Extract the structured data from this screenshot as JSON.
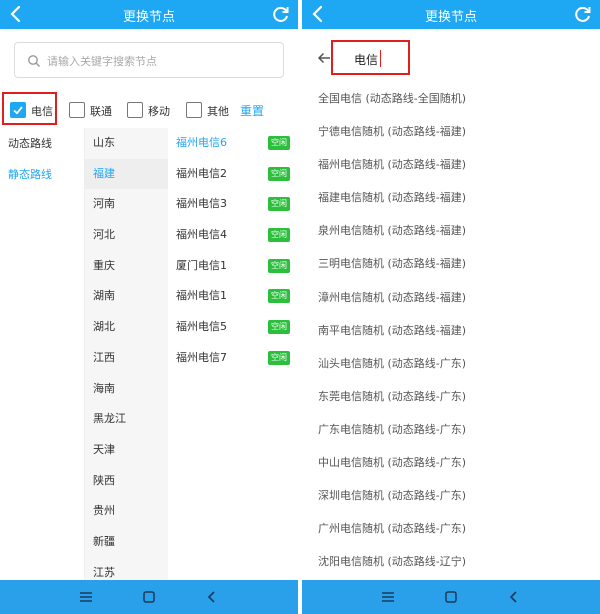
{
  "left": {
    "title": "更换节点",
    "search": {
      "placeholder": "请输入关键字搜索节点"
    },
    "filters": [
      {
        "label": "电信",
        "checked": true
      },
      {
        "label": "联通",
        "checked": false
      },
      {
        "label": "移动",
        "checked": false
      },
      {
        "label": "其他",
        "checked": false
      }
    ],
    "reset_label": "重置",
    "route_types": [
      {
        "label": "动态路线",
        "selected": false
      },
      {
        "label": "静态路线",
        "selected": true
      }
    ],
    "provinces": [
      {
        "label": "山东",
        "selected": false
      },
      {
        "label": "福建",
        "selected": true
      },
      {
        "label": "河南",
        "selected": false
      },
      {
        "label": "河北",
        "selected": false
      },
      {
        "label": "重庆",
        "selected": false
      },
      {
        "label": "湖南",
        "selected": false
      },
      {
        "label": "湖北",
        "selected": false
      },
      {
        "label": "江西",
        "selected": false
      },
      {
        "label": "海南",
        "selected": false
      },
      {
        "label": "黑龙江",
        "selected": false
      },
      {
        "label": "天津",
        "selected": false
      },
      {
        "label": "陕西",
        "selected": false
      },
      {
        "label": "贵州",
        "selected": false
      },
      {
        "label": "新疆",
        "selected": false
      },
      {
        "label": "江苏",
        "selected": false
      }
    ],
    "nodes": [
      {
        "label": "福州电信6",
        "status": "空闲",
        "selected": true
      },
      {
        "label": "福州电信2",
        "status": "空闲",
        "selected": false
      },
      {
        "label": "福州电信3",
        "status": "空闲",
        "selected": false
      },
      {
        "label": "福州电信4",
        "status": "空闲",
        "selected": false
      },
      {
        "label": "厦门电信1",
        "status": "空闲",
        "selected": false
      },
      {
        "label": "福州电信1",
        "status": "空闲",
        "selected": false
      },
      {
        "label": "福州电信5",
        "status": "空闲",
        "selected": false
      },
      {
        "label": "福州电信7",
        "status": "空闲",
        "selected": false
      }
    ]
  },
  "right": {
    "title": "更换节点",
    "search_value": "电信",
    "results": [
      "全国电信 (动态路线-全国随机)",
      "宁德电信随机 (动态路线-福建)",
      "福州电信随机 (动态路线-福建)",
      "福建电信随机 (动态路线-福建)",
      "泉州电信随机 (动态路线-福建)",
      "三明电信随机 (动态路线-福建)",
      "漳州电信随机 (动态路线-福建)",
      "南平电信随机 (动态路线-福建)",
      "汕头电信随机 (动态路线-广东)",
      "东莞电信随机 (动态路线-广东)",
      "广东电信随机 (动态路线-广东)",
      "中山电信随机 (动态路线-广东)",
      "深圳电信随机 (动态路线-广东)",
      "广州电信随机 (动态路线-广东)",
      "沈阳电信随机 (动态路线-辽宁)"
    ]
  },
  "colors": {
    "app_bar": "#1ea7f2",
    "nav_bar": "#2aa0ea",
    "accent": "#1ea7f2",
    "badge_green": "#2bbf3c",
    "highlight_red": "#e01e1e"
  }
}
